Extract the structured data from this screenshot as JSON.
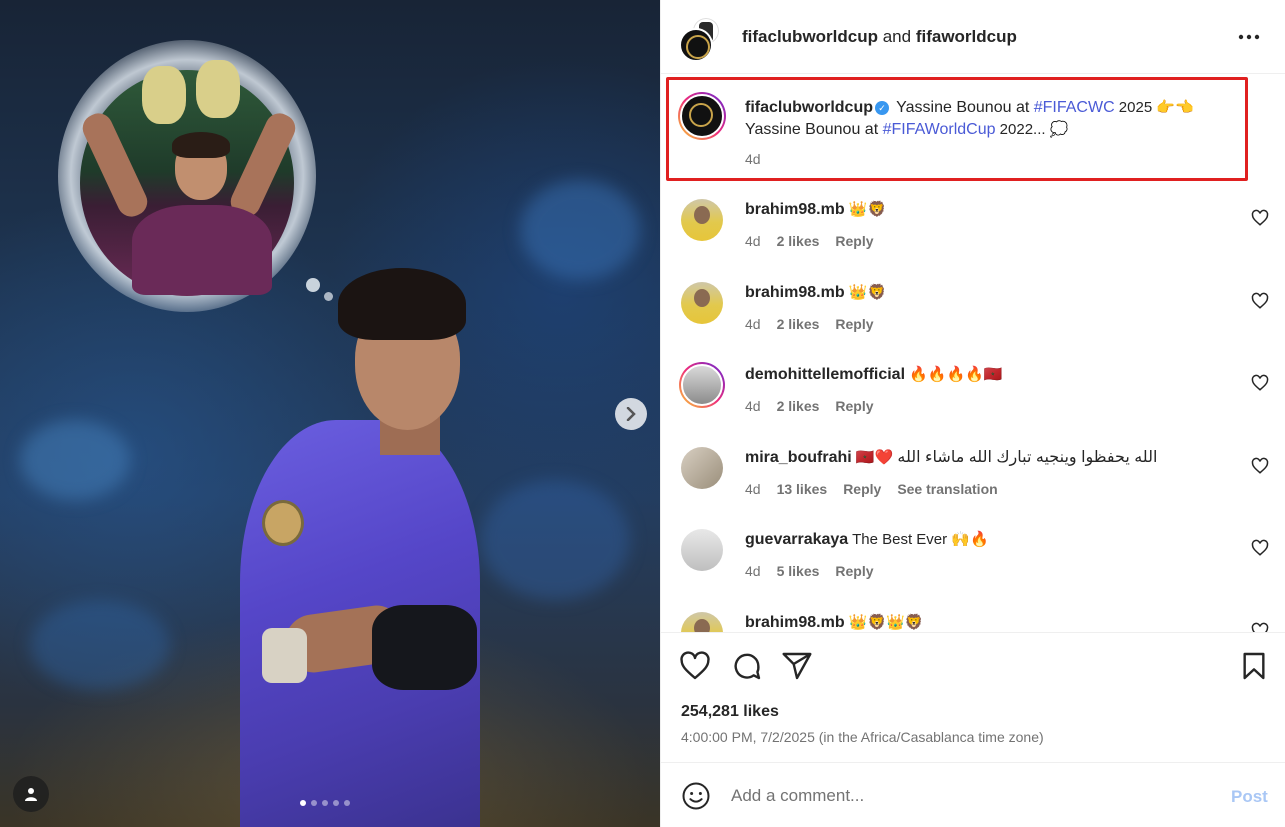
{
  "header": {
    "account_1": "fifaclubworldcup",
    "conjunction": " and ",
    "account_2": "fifaworldcup",
    "more_icon": "more-horizontal-icon",
    "more_label": "•••"
  },
  "caption": {
    "username": "fifaclubworldcup",
    "verified_mark": "✓",
    "line1_pre": " Yassine Bounou at ",
    "hashtag1": "#FIFACWC",
    "line1_post": " 2025 👉👈",
    "line2_pre": "Yassine Bounou at ",
    "hashtag2": "#FIFAWorldCup",
    "line2_post": " 2022... 💭",
    "time": "4d"
  },
  "comments": [
    {
      "username": "brahim98.mb",
      "text": " 👑🦁",
      "time": "4d",
      "likes": "2 likes",
      "reply": "Reply"
    },
    {
      "username": "brahim98.mb",
      "text": " 👑🦁",
      "time": "4d",
      "likes": "2 likes",
      "reply": "Reply"
    },
    {
      "username": "demohittellemofficial",
      "text": " 🔥🔥🔥🔥🇲🇦",
      "time": "4d",
      "likes": "2 likes",
      "reply": "Reply"
    },
    {
      "username": "mira_boufrahi",
      "text_pre": " 🇲🇦❤️ ",
      "text_ar": "الله يحفظوا وينجيه تبارك الله ماشاء الله",
      "time": "4d",
      "likes": "13 likes",
      "reply": "Reply",
      "translate": "See translation"
    },
    {
      "username": "guevarrakaya",
      "text": " The Best Ever 🙌🔥",
      "time": "4d",
      "likes": "5 likes",
      "reply": "Reply"
    },
    {
      "username": "brahim98.mb",
      "text": " 👑🦁👑🦁"
    }
  ],
  "actions": {
    "like_icon": "heart-icon",
    "comment_icon": "comment-icon",
    "share_icon": "share-icon",
    "save_icon": "bookmark-icon",
    "likes_count": "254,281 likes",
    "timestamp": "4:00:00 PM, 7/2/2025 (in the Africa/Casablanca time zone)"
  },
  "composer": {
    "placeholder": "Add a comment...",
    "post_label": "Post",
    "emoji_icon": "smiley-icon"
  },
  "media": {
    "carousel_dots": 5,
    "active_dot": 0,
    "next_icon": "chevron-right-icon",
    "tag_icon": "user-tag-icon"
  },
  "colors": {
    "accent_link": "#4a5ad6",
    "highlight_box": "#e02020",
    "verified": "#3897f0",
    "post_button_disabled": "#a9c7f5"
  }
}
